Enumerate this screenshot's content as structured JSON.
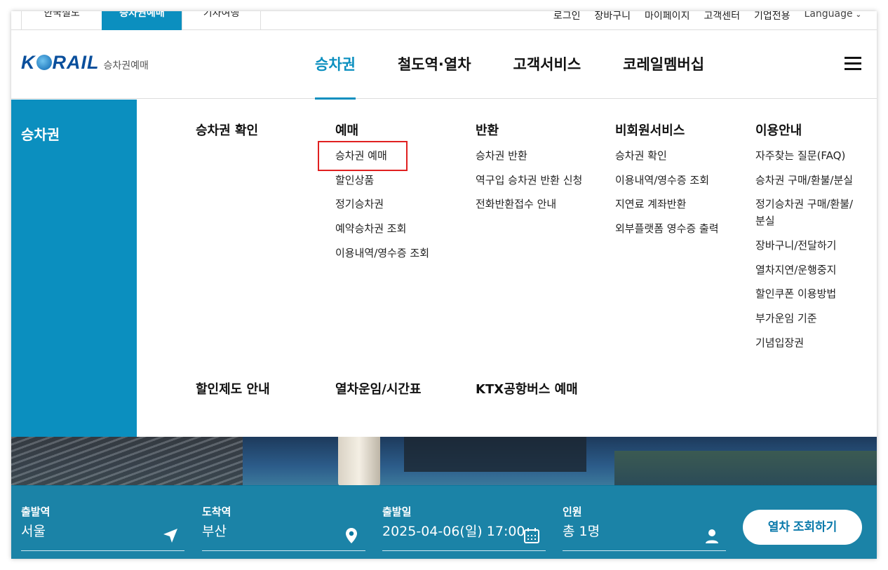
{
  "sites": [
    {
      "label": "한국철도",
      "active": false
    },
    {
      "label": "승차권예매",
      "active": true
    },
    {
      "label": "기차여행",
      "active": false
    }
  ],
  "util_links": [
    "로그인",
    "장바구니",
    "마이페이지",
    "고객센터",
    "기업전용"
  ],
  "language_label": "Language",
  "logo": {
    "mark_pre": "K",
    "mark_post": "RAIL",
    "sub": "승차권예매"
  },
  "gnb": [
    {
      "label": "승차권",
      "active": true
    },
    {
      "label": "철도역·열차",
      "active": false
    },
    {
      "label": "고객서비스",
      "active": false
    },
    {
      "label": "코레일멤버십",
      "active": false
    }
  ],
  "mega": {
    "side_title": "승차권",
    "columns": [
      {
        "title": "승차권 확인",
        "items": []
      },
      {
        "title": "예매",
        "items": [
          "승차권 예매",
          "할인상품",
          "정기승차권",
          "예약승차권 조회",
          "이용내역/영수증 조회"
        ]
      },
      {
        "title": "반환",
        "items": [
          "승차권 반환",
          "역구입 승차권 반환 신청",
          "전화반환접수 안내"
        ]
      },
      {
        "title": "비회원서비스",
        "items": [
          "승차권 확인",
          "이용내역/영수증 조회",
          "지연료 계좌반환",
          "외부플랫폼 영수증 출력"
        ]
      },
      {
        "title": "이용안내",
        "items": [
          "자주찾는 질문(FAQ)",
          "승차권 구매/환불/분실",
          "정기승차권 구매/환불/",
          "분실",
          "장바구니/전달하기",
          "열차지연/운행중지",
          "할인쿠폰 이용방법",
          "부가운임 기준",
          "기념입장권"
        ]
      }
    ],
    "row2": [
      "할인제도 안내",
      "열차운임/시간표",
      "KTX공항버스 예매"
    ]
  },
  "booking": {
    "departure": {
      "label": "출발역",
      "value": "서울"
    },
    "arrival": {
      "label": "도착역",
      "value": "부산"
    },
    "date": {
      "label": "출발일",
      "value": "2025-04-06(일) 17:00"
    },
    "people": {
      "label": "인원",
      "value": "총 1명"
    },
    "search_label": "열차 조회하기"
  },
  "colors": {
    "accent": "#0b8fbf",
    "highlight_box": "#e02020"
  }
}
